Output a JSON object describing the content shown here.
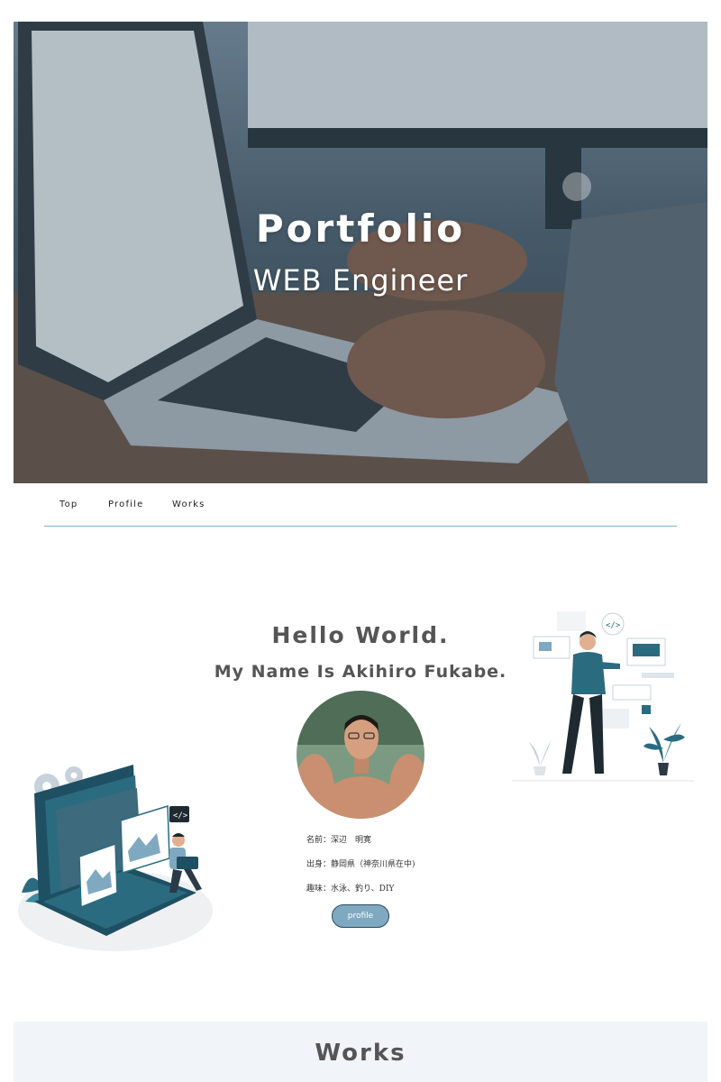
{
  "hero": {
    "title": "Portfolio",
    "subtitle": "WEB Engineer"
  },
  "nav": {
    "items": [
      {
        "label": "Top"
      },
      {
        "label": "Profile"
      },
      {
        "label": "Works"
      }
    ]
  },
  "intro": {
    "greeting": "Hello World.",
    "name_line": "My Name Is Akihiro Fukabe.",
    "details": [
      {
        "text": "名前：深辺　明寛"
      },
      {
        "text": "出身：静岡県（神奈川県在中)"
      },
      {
        "text": "趣味：水泳、釣り、DIY"
      }
    ],
    "button_label": "profile"
  },
  "works": {
    "heading": "Works"
  },
  "colors": {
    "accent": "#7fa9c0",
    "accent_dark": "#2b4a5c",
    "divider": "#7fb0c8",
    "section_bg": "#f1f5f9",
    "illustration_teal": "#2b6b80"
  },
  "icons": [
    "code-icon",
    "image-icon",
    "gear-icon",
    "plant-icon"
  ]
}
